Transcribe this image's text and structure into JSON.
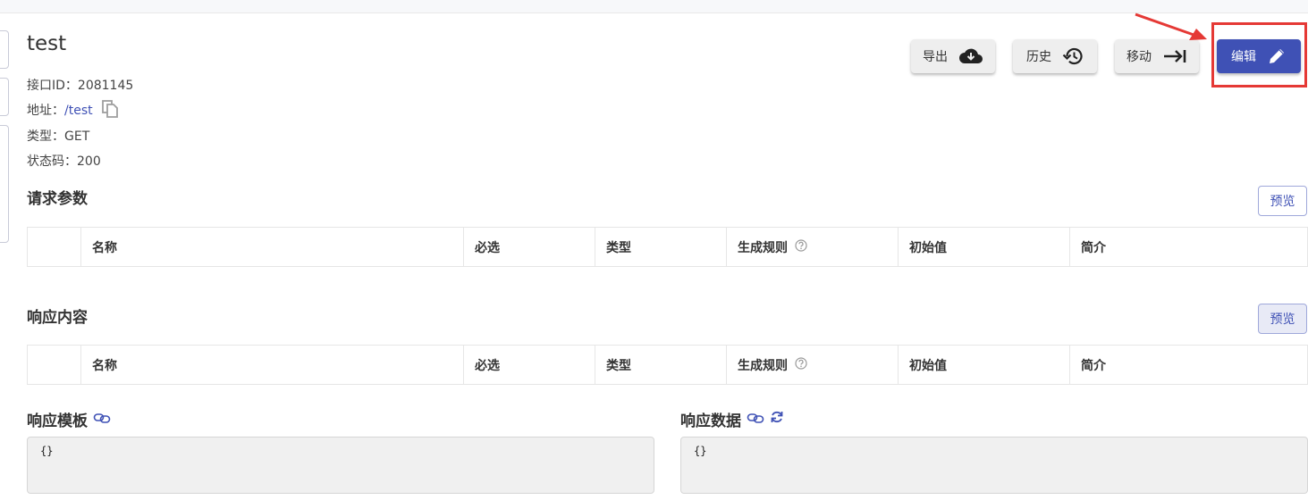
{
  "api": {
    "name": "test",
    "id_label": "接口ID：",
    "id_value": "2081145",
    "url_label": "地址：",
    "url_value": "/test",
    "type_label": "类型：",
    "type_value": "GET",
    "status_label": "状态码：",
    "status_value": "200"
  },
  "actions": {
    "export_label": "导出",
    "history_label": "历史",
    "move_label": "移动",
    "edit_label": "编辑"
  },
  "request": {
    "title": "请求参数",
    "preview_label": "预览",
    "columns": [
      "名称",
      "必选",
      "类型",
      "生成规则",
      "初始值",
      "简介"
    ]
  },
  "response": {
    "title": "响应内容",
    "preview_label": "预览",
    "columns": [
      "名称",
      "必选",
      "类型",
      "生成规则",
      "初始值",
      "简介"
    ]
  },
  "template": {
    "title": "响应模板",
    "content": "{}"
  },
  "data_panel": {
    "title": "响应数据",
    "content": "{}"
  },
  "icons": {
    "export": "cloud-download-icon",
    "history": "history-icon",
    "move": "arrow-to-right-icon",
    "edit": "pencil-icon",
    "copy": "copy-icon",
    "help": "help-circle-icon",
    "link": "link-icon",
    "refresh": "refresh-icon"
  },
  "colors": {
    "primary": "#3f51b5",
    "annotation": "#e53935",
    "button_bg": "#eeeeee",
    "code_bg": "#f0f0f0"
  }
}
